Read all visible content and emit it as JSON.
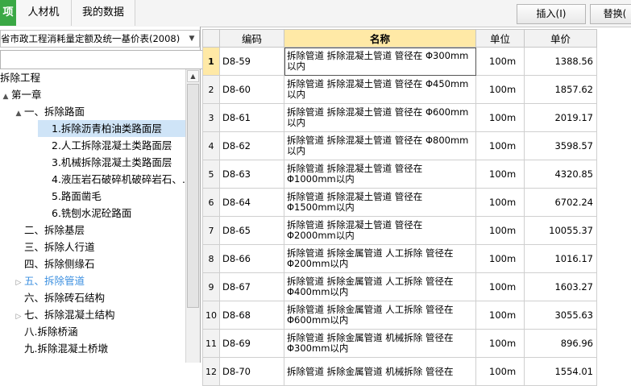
{
  "tabs": [
    {
      "label": "项",
      "active": true
    },
    {
      "label": "人材机",
      "active": false
    },
    {
      "label": "我的数据",
      "active": false
    }
  ],
  "toolbar": {
    "insert_label": "插入(I)",
    "replace_label": "替换("
  },
  "left": {
    "quota_set": "省市政工程消耗量定额及统一基价表(2008)",
    "search_placeholder": ""
  },
  "tree": [
    {
      "label": "拆除工程",
      "toggle": "",
      "selected": false,
      "blue": false
    },
    {
      "label": "第一章",
      "toggle": "▲",
      "selected": false,
      "blue": false
    },
    {
      "label": "一、拆除路面",
      "toggle": "▲",
      "selected": false,
      "blue": false
    },
    {
      "label": "1.拆除沥青柏油类路面层",
      "toggle": "",
      "selected": true,
      "blue": false
    },
    {
      "label": "2.人工拆除混凝土类路面层",
      "toggle": "",
      "selected": false,
      "blue": false
    },
    {
      "label": "3.机械拆除混凝土类路面层",
      "toggle": "",
      "selected": false,
      "blue": false
    },
    {
      "label": "4.液压岩石破碎机破碎岩石、…",
      "toggle": "",
      "selected": false,
      "blue": false
    },
    {
      "label": "5.路面凿毛",
      "toggle": "",
      "selected": false,
      "blue": false
    },
    {
      "label": "6.铣刨水泥砼路面",
      "toggle": "",
      "selected": false,
      "blue": false
    },
    {
      "label": "二、拆除基层",
      "toggle": "",
      "selected": false,
      "blue": false
    },
    {
      "label": "三、拆除人行道",
      "toggle": "",
      "selected": false,
      "blue": false
    },
    {
      "label": "四、拆除侧缘石",
      "toggle": "",
      "selected": false,
      "blue": false
    },
    {
      "label": "五、拆除管道",
      "toggle": "▷",
      "selected": false,
      "blue": true
    },
    {
      "label": "六、拆除砖石结构",
      "toggle": "",
      "selected": false,
      "blue": false
    },
    {
      "label": "七、拆除混凝土结构",
      "toggle": "▷",
      "selected": false,
      "blue": false
    },
    {
      "label": "八.拆除桥涵",
      "toggle": "",
      "selected": false,
      "blue": false
    },
    {
      "label": "九.拆除混凝土桥墩",
      "toggle": "",
      "selected": false,
      "blue": false
    }
  ],
  "table": {
    "headers": {
      "code": "编码",
      "name": "名称",
      "unit": "单位",
      "price": "单价"
    },
    "rows": [
      {
        "no": "1",
        "code": "D8-59",
        "name": "拆除管道 拆除混凝土管道 管径在 Φ300mm以内",
        "unit": "100m",
        "price": "1388.56"
      },
      {
        "no": "2",
        "code": "D8-60",
        "name": "拆除管道 拆除混凝土管道 管径在 Φ450mm以内",
        "unit": "100m",
        "price": "1857.62"
      },
      {
        "no": "3",
        "code": "D8-61",
        "name": "拆除管道 拆除混凝土管道 管径在 Φ600mm以内",
        "unit": "100m",
        "price": "2019.17"
      },
      {
        "no": "4",
        "code": "D8-62",
        "name": "拆除管道 拆除混凝土管道 管径在 Φ800mm以内",
        "unit": "100m",
        "price": "3598.57"
      },
      {
        "no": "5",
        "code": "D8-63",
        "name": "拆除管道 拆除混凝土管道 管径在 Φ1000mm以内",
        "unit": "100m",
        "price": "4320.85"
      },
      {
        "no": "6",
        "code": "D8-64",
        "name": "拆除管道 拆除混凝土管道 管径在 Φ1500mm以内",
        "unit": "100m",
        "price": "6702.24"
      },
      {
        "no": "7",
        "code": "D8-65",
        "name": "拆除管道 拆除混凝土管道 管径在 Φ2000mm以内",
        "unit": "100m",
        "price": "10055.37"
      },
      {
        "no": "8",
        "code": "D8-66",
        "name": "拆除管道 拆除金属管道 人工拆除 管径在 Φ200mm以内",
        "unit": "100m",
        "price": "1016.17"
      },
      {
        "no": "9",
        "code": "D8-67",
        "name": "拆除管道 拆除金属管道 人工拆除 管径在 Φ400mm以内",
        "unit": "100m",
        "price": "1603.27"
      },
      {
        "no": "10",
        "code": "D8-68",
        "name": "拆除管道 拆除金属管道 人工拆除 管径在 Φ600mm以内",
        "unit": "100m",
        "price": "3055.63"
      },
      {
        "no": "11",
        "code": "D8-69",
        "name": "拆除管道 拆除金属管道 机械拆除 管径在 Φ300mm以内",
        "unit": "100m",
        "price": "896.96"
      },
      {
        "no": "12",
        "code": "D8-70",
        "name": "拆除管道 拆除金属管道 机械拆除 管径在",
        "unit": "100m",
        "price": "1554.01"
      }
    ]
  }
}
